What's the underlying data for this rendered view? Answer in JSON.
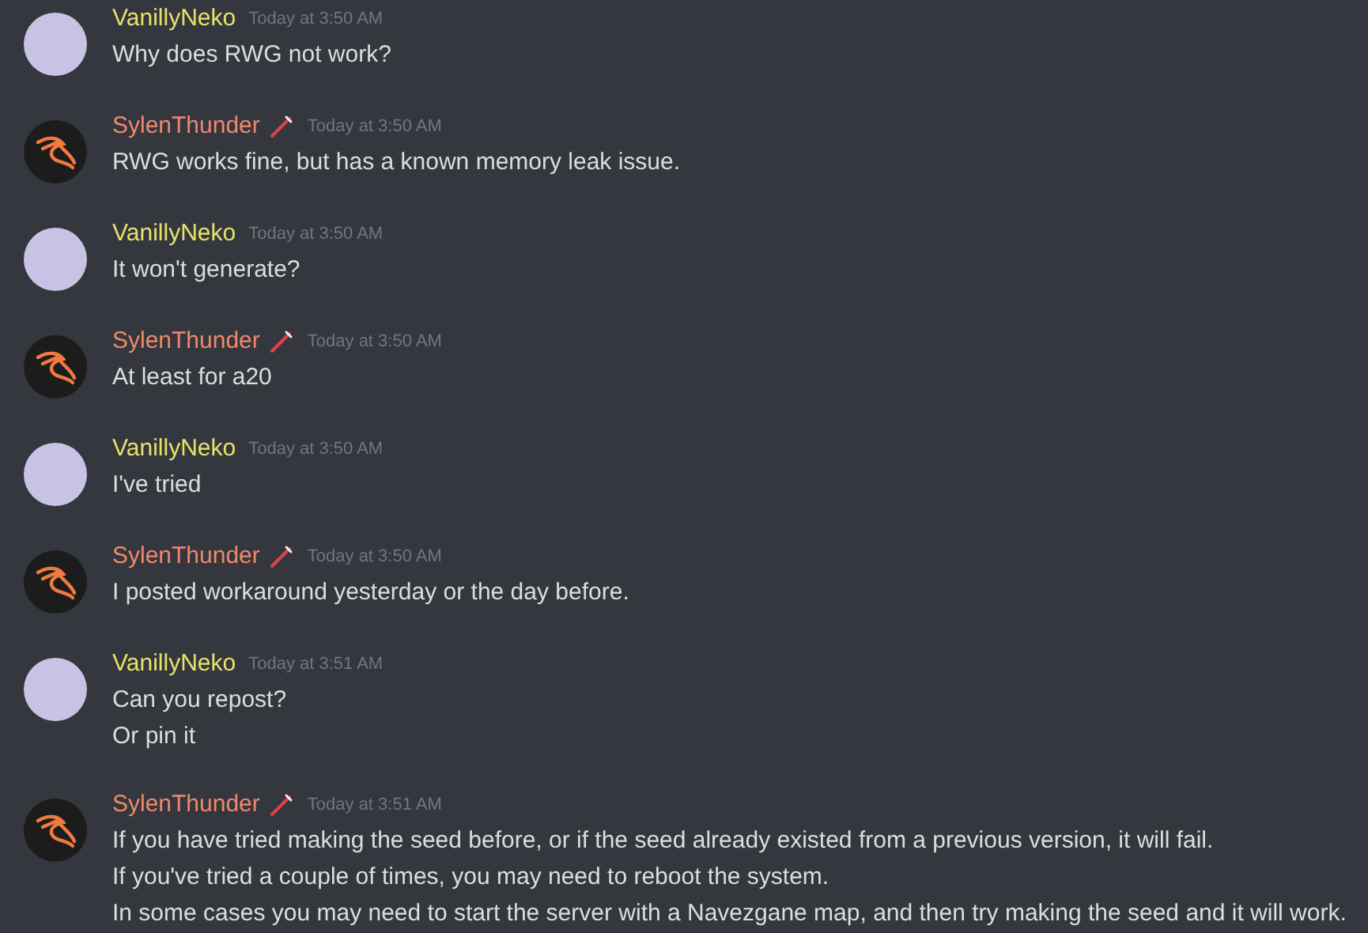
{
  "messages": [
    {
      "author": "VanillyNeko",
      "color": "#e6e36a",
      "kind": "photo",
      "badge": false,
      "time": "Today at 3:50 AM",
      "lines": [
        "Why does RWG not work?"
      ]
    },
    {
      "author": "SylenThunder",
      "color": "#f0886c",
      "kind": "logo",
      "badge": true,
      "time": "Today at 3:50 AM",
      "lines": [
        "RWG works fine, but has a known memory leak issue."
      ]
    },
    {
      "author": "VanillyNeko",
      "color": "#e6e36a",
      "kind": "photo",
      "badge": false,
      "time": "Today at 3:50 AM",
      "lines": [
        "It won't generate?"
      ]
    },
    {
      "author": "SylenThunder",
      "color": "#f0886c",
      "kind": "logo",
      "badge": true,
      "time": "Today at 3:50 AM",
      "lines": [
        "At least for a20"
      ]
    },
    {
      "author": "VanillyNeko",
      "color": "#e6e36a",
      "kind": "photo",
      "badge": false,
      "time": "Today at 3:50 AM",
      "lines": [
        "I've tried"
      ]
    },
    {
      "author": "SylenThunder",
      "color": "#f0886c",
      "kind": "logo",
      "badge": true,
      "time": "Today at 3:50 AM",
      "lines": [
        "I posted workaround yesterday or the day before."
      ]
    },
    {
      "author": "VanillyNeko",
      "color": "#e6e36a",
      "kind": "photo",
      "badge": false,
      "time": "Today at 3:51 AM",
      "lines": [
        "Can you repost?",
        "Or pin it"
      ]
    },
    {
      "author": "SylenThunder",
      "color": "#f0886c",
      "kind": "logo",
      "badge": true,
      "time": "Today at 3:51 AM",
      "lines": [
        "If you have tried making the seed before, or if the seed already existed from a previous version, it will fail.",
        "If you've tried a couple of times, you may need to reboot the system.",
        "In some cases you may need to start the server with a Navezgane map, and then try making the seed and it will work."
      ]
    }
  ]
}
